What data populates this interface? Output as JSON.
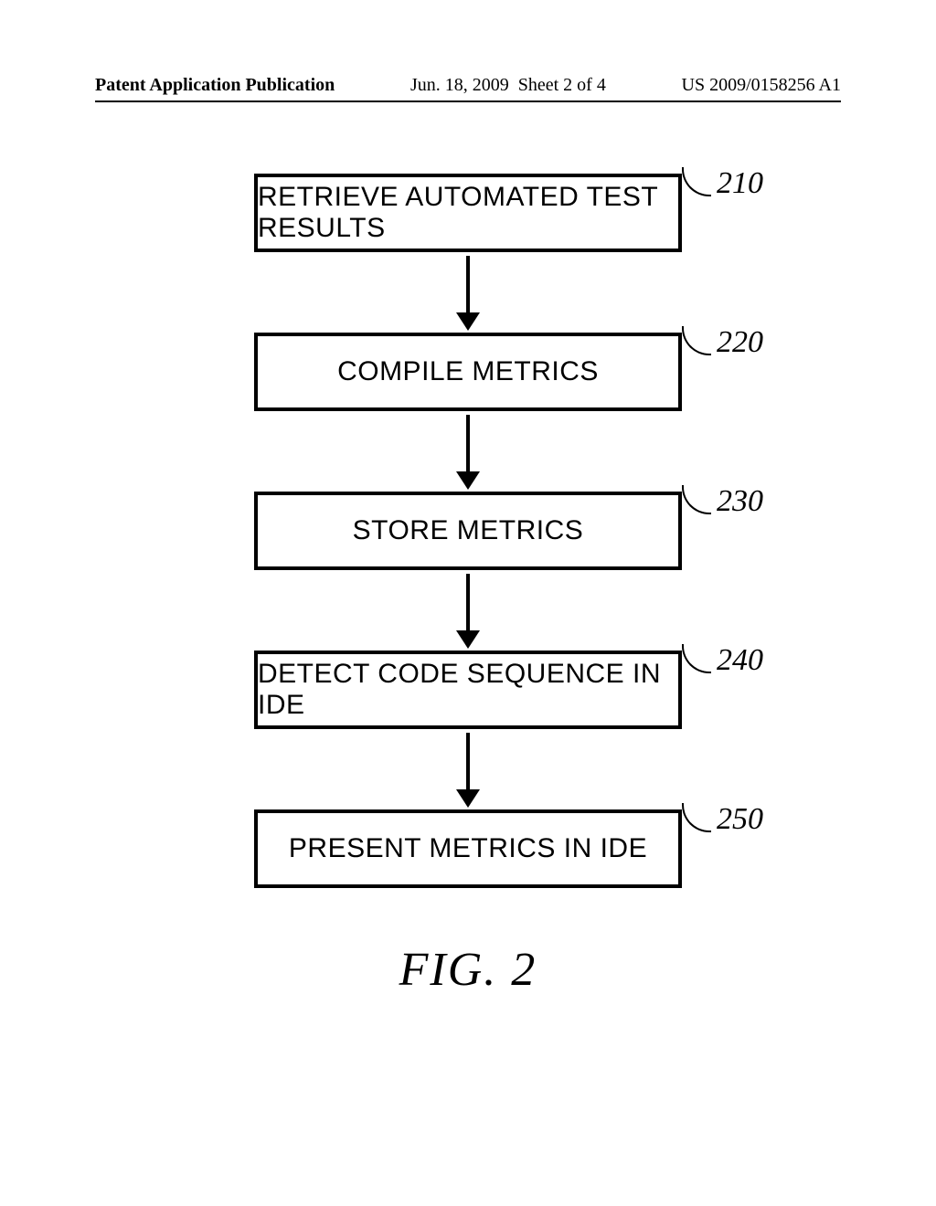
{
  "header": {
    "pubtype": "Patent Application Publication",
    "date": "Jun. 18, 2009",
    "sheet": "Sheet 2 of 4",
    "pubnum": "US 2009/0158256 A1"
  },
  "flowchart": {
    "steps": [
      {
        "ref": "210",
        "label": "RETRIEVE AUTOMATED TEST RESULTS"
      },
      {
        "ref": "220",
        "label": "COMPILE METRICS"
      },
      {
        "ref": "230",
        "label": "STORE METRICS"
      },
      {
        "ref": "240",
        "label": "DETECT CODE SEQUENCE IN IDE"
      },
      {
        "ref": "250",
        "label": "PRESENT METRICS IN IDE"
      }
    ],
    "caption": "FIG. 2"
  }
}
